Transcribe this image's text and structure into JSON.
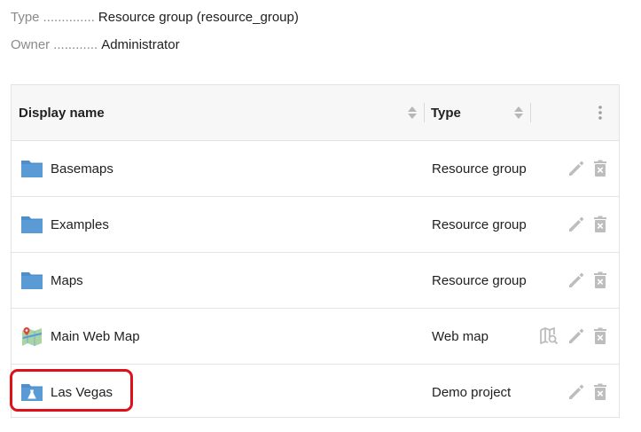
{
  "meta": {
    "type_label": "Type",
    "type_dots": "..............",
    "type_value": "Resource group (resource_group)",
    "owner_label": "Owner",
    "owner_dots": "............",
    "owner_value": "Administrator"
  },
  "table": {
    "columns": [
      "Display name",
      "Type"
    ],
    "rows": [
      {
        "name": "Basemaps",
        "type": "Resource group",
        "icon": "folder-icon",
        "actions": [
          "edit",
          "delete"
        ]
      },
      {
        "name": "Examples",
        "type": "Resource group",
        "icon": "folder-icon",
        "actions": [
          "edit",
          "delete"
        ]
      },
      {
        "name": "Maps",
        "type": "Resource group",
        "icon": "folder-icon",
        "actions": [
          "edit",
          "delete"
        ]
      },
      {
        "name": "Main Web Map",
        "type": "Web map",
        "icon": "webmap-icon",
        "actions": [
          "preview",
          "edit",
          "delete"
        ]
      },
      {
        "name": "Las Vegas",
        "type": "Demo project",
        "icon": "demo-project-folder-icon",
        "actions": [
          "edit",
          "delete"
        ]
      }
    ]
  },
  "colors": {
    "folder": "#5b9bd5",
    "action_icon": "#bdbdbd",
    "highlight": "#e0101a"
  }
}
